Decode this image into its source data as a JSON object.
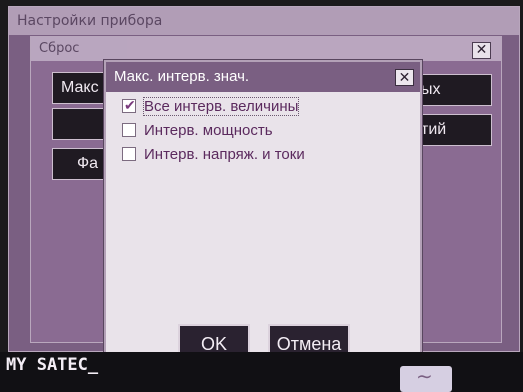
{
  "back_window": {
    "title": "Настройки прибора"
  },
  "sub_window": {
    "title": "Сброс",
    "buttons": [
      "Макс",
      "",
      "Фа",
      "ых",
      "тий"
    ]
  },
  "dialog": {
    "title": "Макс. интерв. знач.",
    "close_label": "✕",
    "options": [
      {
        "label": "Все интерв. величины",
        "checked": true
      },
      {
        "label": "Интерв. мощность",
        "checked": false
      },
      {
        "label": "Интерв. напряж. и токи",
        "checked": false
      }
    ],
    "ok_label": "OK",
    "cancel_label": "Отмена"
  },
  "status_bar": {
    "text": "MY SATEC_"
  }
}
